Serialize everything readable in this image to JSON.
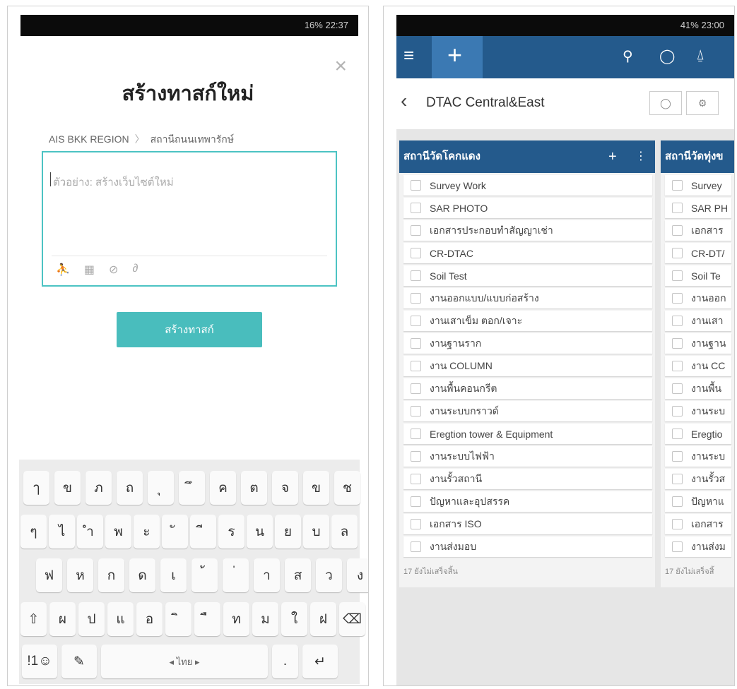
{
  "left_screen": {
    "status": "16% 22:37",
    "close_icon": "close-icon",
    "title": "สร้างทาสก์ใหม่",
    "breadcrumb": [
      "AIS BKK REGION",
      "สถานีถนนเทพารักษ์"
    ],
    "input_placeholder": "ตัวอย่าง: สร้างเว็บไซต์ใหม่",
    "tools": [
      "person-icon",
      "calendar-icon",
      "tag-icon",
      "link-icon"
    ],
    "create_button": "สร้างทาสก์",
    "keyboard": {
      "row1": [
        "ๅ",
        "ข",
        "ภ",
        "ถ",
        "ุ",
        "ึ",
        "ค",
        "ต",
        "จ",
        "ข",
        "ช"
      ],
      "row2": [
        "ๆ",
        "ไ",
        "ำ",
        "พ",
        "ะ",
        "ั",
        "ี",
        "ร",
        "น",
        "ย",
        "บ",
        "ล"
      ],
      "row3": [
        "ฟ",
        "ห",
        "ก",
        "ด",
        "เ",
        "้",
        "่",
        "า",
        "ส",
        "ว",
        "ง"
      ],
      "row4": [
        "ผ",
        "ป",
        "แ",
        "อ",
        "ิ",
        "ื",
        "ท",
        "ม",
        "ใ",
        "ฝ"
      ],
      "shift": "⇧",
      "backspace": "⌫",
      "symbols": "!1☺",
      "handwriting": "✎",
      "space": "◂ ไทย ▸",
      "period": ".",
      "enter": "↵"
    }
  },
  "right_screen": {
    "status": "41% 23:00",
    "topbar": {
      "menu_icon": "≡",
      "add_icon": "+",
      "search_icon": "🔍",
      "chat_icon": "💬",
      "bell_icon": "🔔"
    },
    "project_name": "DTAC Central&East",
    "columns": [
      {
        "title": "สถานีวัดโคกแดง",
        "tasks": [
          "Survey Work",
          "SAR PHOTO",
          "เอกสารประกอบทำสัญญาเช่า",
          "CR-DTAC",
          "Soil Test",
          "งานออกแบบ/แบบก่อสร้าง",
          "งานเสาเข็ม ตอก/เจาะ",
          "งานฐานราก",
          "งาน COLUMN",
          "งานพื้นคอนกรีต",
          "งานระบบกราวด์",
          "Eregtion tower & Equipment",
          "งานระบบไฟฟ้า",
          "งานรั้วสถานี",
          "ปัญหาและอุปสรรค",
          "เอกสาร ISO",
          "งานส่งมอบ"
        ],
        "footer": "17 ยังไม่เสร็จสิ้น"
      },
      {
        "title": "สถานีวัดทุ่งข",
        "tasks": [
          "Survey",
          "SAR PH",
          "เอกสาร",
          "CR-DT/",
          "Soil Te",
          "งานออก",
          "งานเสา",
          "งานฐาน",
          "งาน CC",
          "งานพื้น",
          "งานระบ",
          "Eregtio",
          "งานระบ",
          "งานรั้วส",
          "ปัญหาแ",
          "เอกสาร",
          "งานส่งม"
        ],
        "footer": "17 ยังไม่เสร็จสิ้"
      }
    ]
  }
}
